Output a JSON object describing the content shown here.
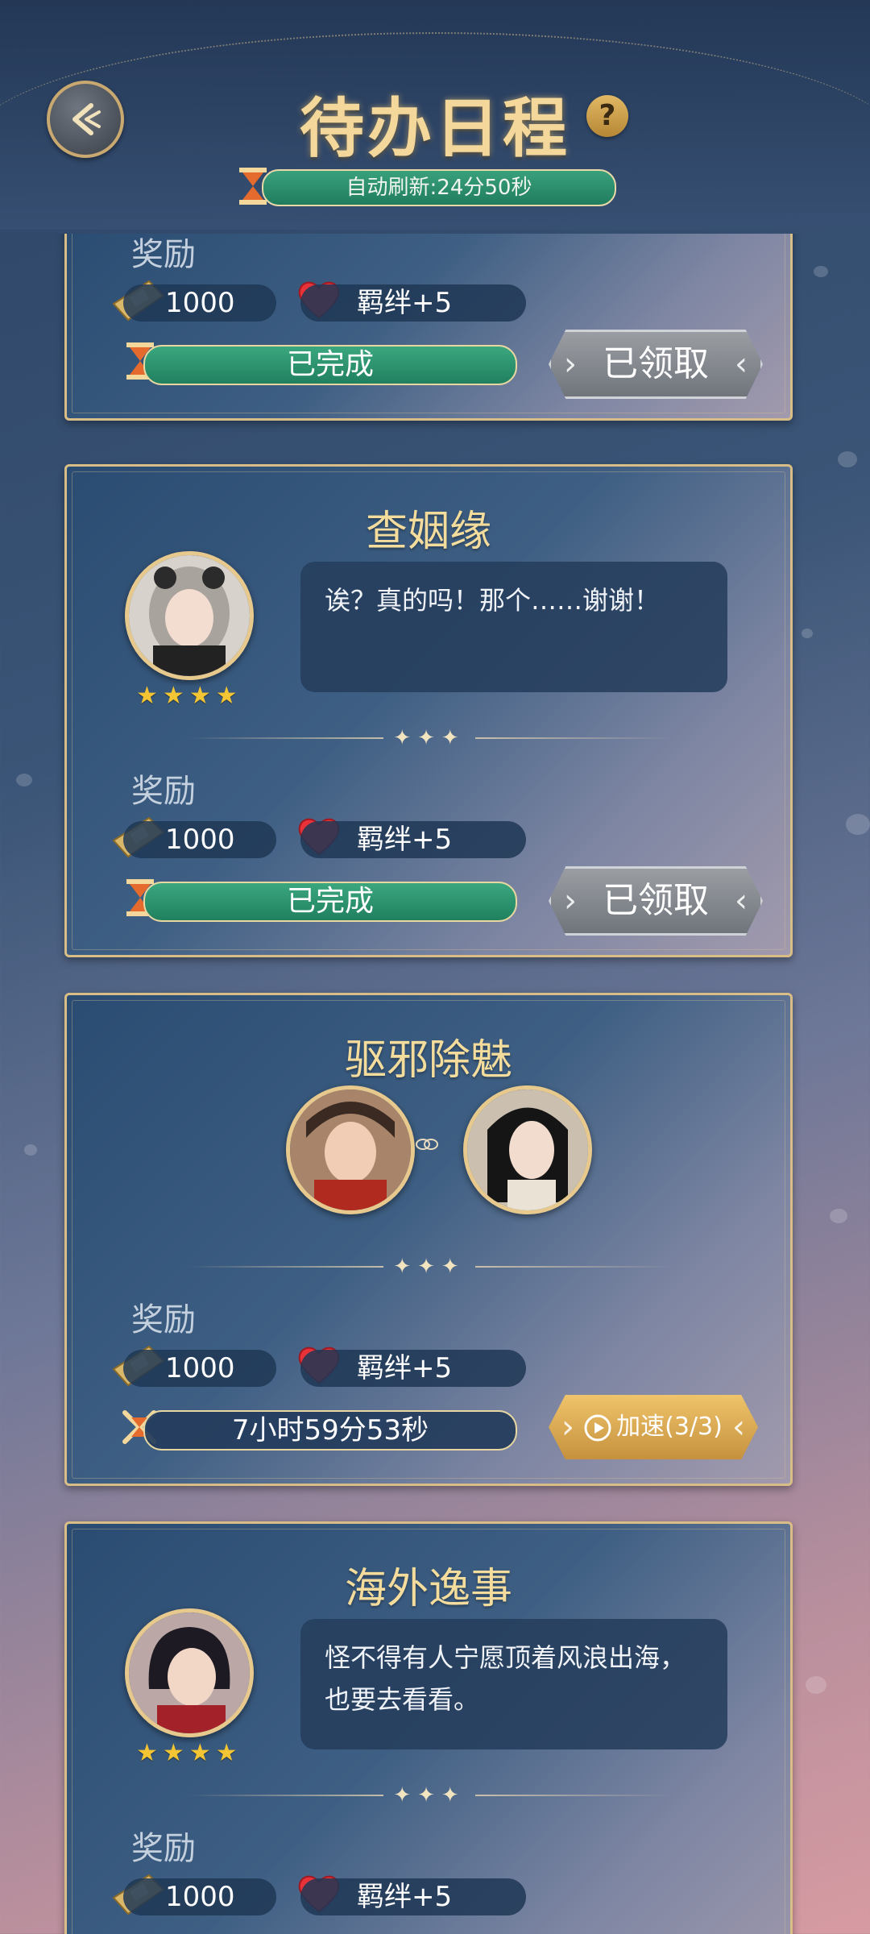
{
  "header": {
    "title": "待办日程",
    "help_glyph": "?",
    "refresh_text": "自动刷新:24分50秒"
  },
  "reward_label": "奖励",
  "cards": [
    {
      "title": "",
      "reward_coin": "1000",
      "reward_bond": "羁绊+5",
      "status": "已完成",
      "button": "已领取"
    },
    {
      "title": "查姻缘",
      "stars": 4,
      "dialogue": "诶？真的吗！那个……谢谢！",
      "reward_coin": "1000",
      "reward_bond": "羁绊+5",
      "status": "已完成",
      "button": "已领取"
    },
    {
      "title": "驱邪除魅",
      "reward_coin": "1000",
      "reward_bond": "羁绊+5",
      "timer": "7小时59分53秒",
      "button": "加速(3/3)"
    },
    {
      "title": "海外逸事",
      "stars": 4,
      "dialogue": "怪不得有人宁愿顶着风浪出海，也要去看看。",
      "reward_coin": "1000",
      "reward_bond": "羁绊+5"
    }
  ],
  "colors": {
    "gold": "#f3dc9c",
    "status_green": "#2f9470",
    "claimed_gray": "#8a8e94",
    "speed_gold": "#dcaa55"
  }
}
